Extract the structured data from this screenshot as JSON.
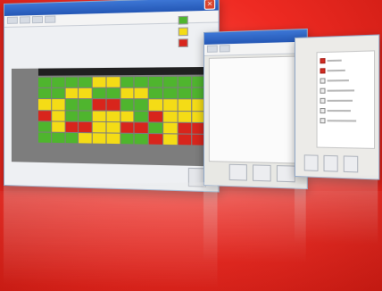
{
  "colors": {
    "background": "#e8281f",
    "green": "#4fb52e",
    "yellow": "#f4dc16",
    "red": "#d8251c",
    "grey": "#d4d4d4",
    "panel": "#7d7d7d",
    "titlebar": "#2f63c3"
  },
  "icons": {
    "close": "close-icon",
    "legend_green": "green-swatch",
    "legend_yellow": "yellow-swatch",
    "legend_red": "red-swatch"
  },
  "grid": {
    "rows": [
      [
        "G",
        "G",
        "G",
        "G",
        "Y",
        "Y",
        "G",
        "G",
        "G",
        "G",
        "G",
        "G"
      ],
      [
        "G",
        "G",
        "Y",
        "Y",
        "G",
        "G",
        "Y",
        "Y",
        "G",
        "G",
        "G",
        "G"
      ],
      [
        "Y",
        "Y",
        "G",
        "G",
        "R",
        "R",
        "G",
        "G",
        "Y",
        "Y",
        "Y",
        "Y"
      ],
      [
        "R",
        "Y",
        "G",
        "G",
        "Y",
        "Y",
        "Y",
        "G",
        "R",
        "Y",
        "Y",
        "Y"
      ],
      [
        "G",
        "Y",
        "R",
        "R",
        "Y",
        "Y",
        "R",
        "R",
        "G",
        "Y",
        "R",
        "R"
      ],
      [
        "G",
        "G",
        "G",
        "Y",
        "Y",
        "Y",
        "G",
        "G",
        "R",
        "Y",
        "R",
        "R"
      ]
    ]
  }
}
